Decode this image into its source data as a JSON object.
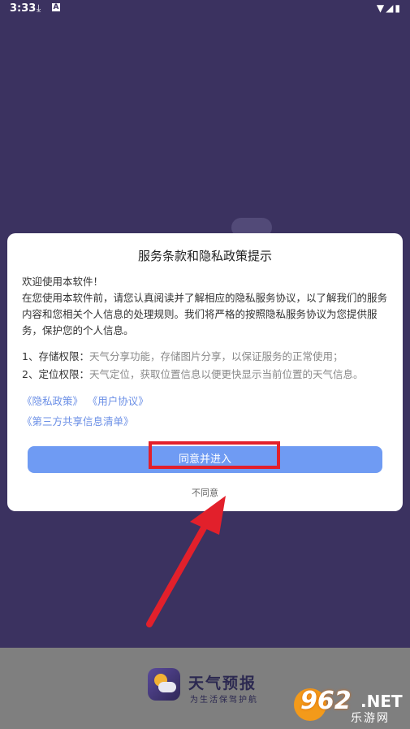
{
  "status_bar": {
    "time": "3:33",
    "download_icon": "download-icon",
    "a_icon": "a-icon",
    "right_icons": "wifi-icon signal-icon battery-icon"
  },
  "dialog": {
    "title": "服务条款和隐私政策提示",
    "greeting": "欢迎使用本软件！",
    "paragraph": "在您使用本软件前，请您认真阅读并了解相应的隐私服务协议，以了解我们的服务内容和您相关个人信息的处理规则。我们将严格的按照隐私服务协议为您提供服务，保护您的个人信息。",
    "permissions": [
      {
        "label": "1、存储权限：",
        "text": "天气分享功能，存储图片分享，以保证服务的正常使用；"
      },
      {
        "label": "2、定位权限：",
        "text": "天气定位，获取位置信息以便更快显示当前位置的天气信息。"
      }
    ],
    "links": {
      "privacy": "《隐私政策》",
      "user_agreement": "《用户协议》",
      "third_party": "《第三方共享信息清单》"
    },
    "agree_button": "同意并进入",
    "disagree_button": "不同意"
  },
  "app": {
    "name": "天气预报",
    "slogan": "为生活保驾护航"
  },
  "watermark": {
    "number": "962",
    "net": ".NET",
    "sub": "乐游网"
  },
  "colors": {
    "background": "#3b3260",
    "accent_button": "#6f9bf3",
    "link": "#6b8fe6",
    "annotation": "#e2202b"
  }
}
